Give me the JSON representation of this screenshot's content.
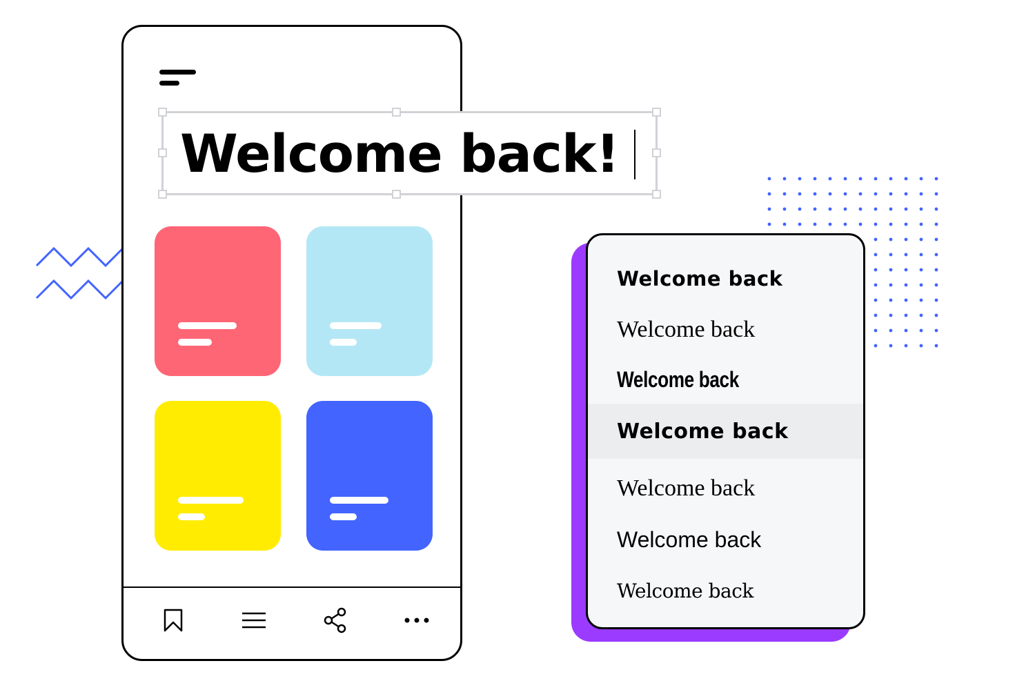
{
  "colors": {
    "accent_blue": "#4364ff",
    "card_red": "#ff6675",
    "card_cyan": "#b4e7f5",
    "card_yellow": "#ffec00",
    "card_blue": "#4364ff",
    "picker_shadow": "#9b3bff",
    "picker_bg": "#f6f7f9",
    "picker_selected_bg": "#ecedef",
    "selection_border": "#d0d2d6"
  },
  "phone": {
    "headline": "Welcome back!",
    "cards": [
      {
        "name": "red-card",
        "color": "#ff6675"
      },
      {
        "name": "cyan-card",
        "color": "#b4e7f5"
      },
      {
        "name": "yellow-card",
        "color": "#ffec00"
      },
      {
        "name": "blue-card",
        "color": "#4364ff"
      }
    ],
    "bottom_nav": [
      {
        "icon": "bookmark-icon"
      },
      {
        "icon": "menu-icon"
      },
      {
        "icon": "share-icon"
      },
      {
        "icon": "more-icon"
      }
    ]
  },
  "font_picker": {
    "selected_index": 3,
    "items": [
      {
        "label": "Welcome back",
        "style": "geometric-bold"
      },
      {
        "label": "Welcome back",
        "style": "serif"
      },
      {
        "label": "Welcome back",
        "style": "condensed-bold"
      },
      {
        "label": "Welcome back",
        "style": "geometric-bold"
      },
      {
        "label": "Welcome back",
        "style": "serif"
      },
      {
        "label": "Welcome back",
        "style": "sans"
      },
      {
        "label": "Welcome back",
        "style": "serif-old-style"
      }
    ]
  }
}
